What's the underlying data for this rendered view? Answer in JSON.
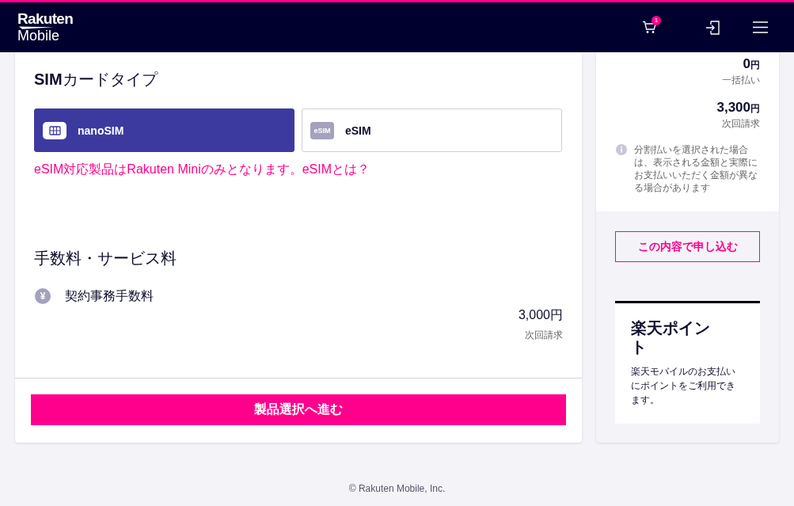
{
  "header": {
    "logo": {
      "brand": "Rakuten",
      "product": "Mobile"
    },
    "actions": [
      {
        "kind": "cart",
        "badge": "1"
      },
      {
        "kind": "login"
      },
      {
        "kind": "menu"
      }
    ]
  },
  "sim_type": {
    "title": "**SIM**カードタイプ",
    "options": [
      {
        "kind": "chip",
        "label": "nanoSIM",
        "selected": true
      },
      {
        "kind": "text",
        "icon_text": "eSIM",
        "label": "eSIM",
        "selected": false
      }
    ],
    "note": "eSIM対応製品はRakuten Miniのみとなります。",
    "note_link": "eSIMとは？"
  },
  "fees": {
    "title": "手数料・サービス料",
    "items": [
      {
        "icon": "¥",
        "label": "契約事務手数料",
        "price": "3,000円",
        "billing": "次回請求"
      }
    ]
  },
  "next_button": "製品選択へ進む",
  "summary": {
    "prices": [
      {
        "amount": "0",
        "unit": "円",
        "label": "一括払い"
      },
      {
        "amount": "3,300",
        "unit": "円",
        "label": "次回請求"
      }
    ],
    "note": "分割払いを選択された場合は、表示される金額と実際にお支払いいただく金額が異なる場合があります",
    "apply_button": "この内容で申し込む"
  },
  "points": {
    "title": "楽天ポイント",
    "text": "楽天モバイルのお支払いにポイントをご利用できます。"
  },
  "footer": "© Rakuten Mobile, Inc."
}
